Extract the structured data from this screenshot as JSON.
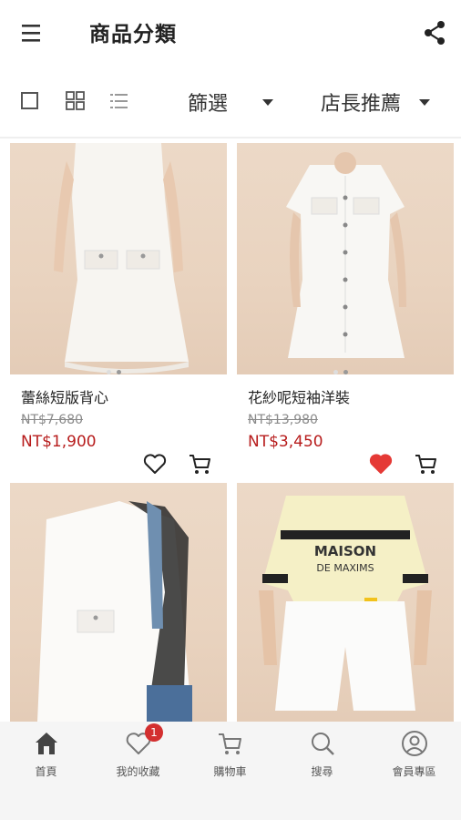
{
  "appbar": {
    "title": "商品分類"
  },
  "toolbar": {
    "filter_label": "篩選",
    "sort_label": "店長推薦"
  },
  "products": [
    {
      "name": "蕾絲短版背心",
      "old_price": "NT$7,680",
      "price": "NT$1,900",
      "favorited": false
    },
    {
      "name": "花紗呢短袖洋裝",
      "old_price": "NT$13,980",
      "price": "NT$3,450",
      "favorited": true
    },
    {
      "name": "",
      "old_price": "",
      "price": "",
      "favorited": false
    },
    {
      "name": "",
      "old_price": "",
      "price": "",
      "favorited": false
    }
  ],
  "bottom_nav": {
    "items": [
      {
        "label": "首頁",
        "icon": "home-icon"
      },
      {
        "label": "我的收藏",
        "icon": "heart-icon",
        "badge": "1"
      },
      {
        "label": "購物車",
        "icon": "cart-icon"
      },
      {
        "label": "搜尋",
        "icon": "search-icon"
      },
      {
        "label": "會員專區",
        "icon": "user-icon"
      }
    ]
  },
  "colors": {
    "accent": "#b71c1c",
    "heart_active": "#e53935",
    "badge": "#d32f2f"
  }
}
